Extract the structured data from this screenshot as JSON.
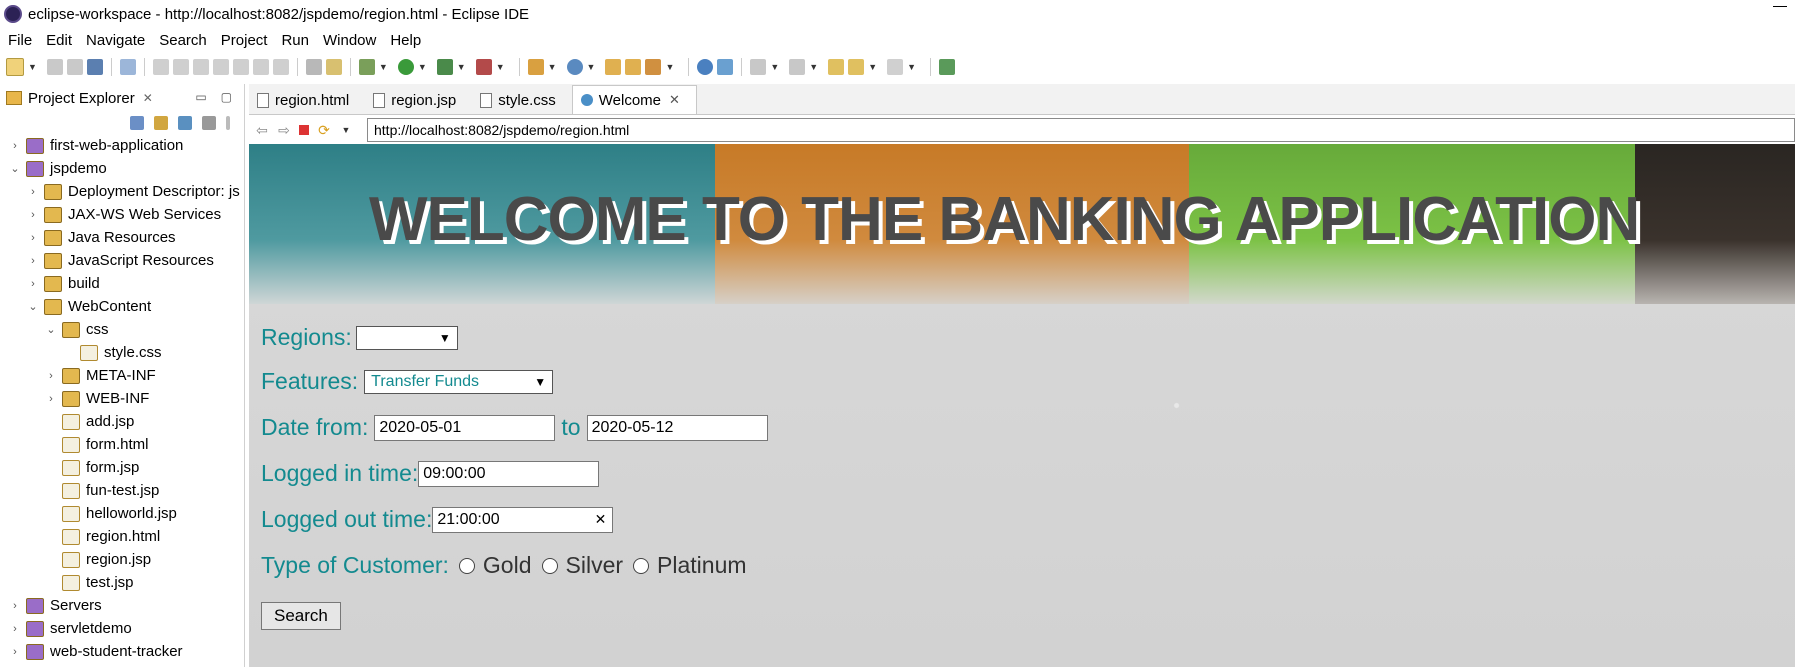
{
  "window": {
    "title": "eclipse-workspace - http://localhost:8082/jspdemo/region.html - Eclipse IDE"
  },
  "menu": [
    "File",
    "Edit",
    "Navigate",
    "Search",
    "Project",
    "Run",
    "Window",
    "Help"
  ],
  "explorer": {
    "title": "Project Explorer",
    "items": [
      {
        "label": "first-web-application",
        "indent": 0,
        "chev": "›"
      },
      {
        "label": "jspdemo",
        "indent": 0,
        "chev": "⌄"
      },
      {
        "label": "Deployment Descriptor: js",
        "indent": 1,
        "chev": "›"
      },
      {
        "label": "JAX-WS Web Services",
        "indent": 1,
        "chev": "›"
      },
      {
        "label": "Java Resources",
        "indent": 1,
        "chev": "›"
      },
      {
        "label": "JavaScript Resources",
        "indent": 1,
        "chev": "›"
      },
      {
        "label": "build",
        "indent": 1,
        "chev": "›"
      },
      {
        "label": "WebContent",
        "indent": 1,
        "chev": "⌄"
      },
      {
        "label": "css",
        "indent": 2,
        "chev": "⌄"
      },
      {
        "label": "style.css",
        "indent": 3,
        "chev": ""
      },
      {
        "label": "META-INF",
        "indent": 2,
        "chev": "›"
      },
      {
        "label": "WEB-INF",
        "indent": 2,
        "chev": "›"
      },
      {
        "label": "add.jsp",
        "indent": 2,
        "chev": ""
      },
      {
        "label": "form.html",
        "indent": 2,
        "chev": ""
      },
      {
        "label": "form.jsp",
        "indent": 2,
        "chev": ""
      },
      {
        "label": "fun-test.jsp",
        "indent": 2,
        "chev": ""
      },
      {
        "label": "helloworld.jsp",
        "indent": 2,
        "chev": ""
      },
      {
        "label": "region.html",
        "indent": 2,
        "chev": ""
      },
      {
        "label": "region.jsp",
        "indent": 2,
        "chev": ""
      },
      {
        "label": "test.jsp",
        "indent": 2,
        "chev": ""
      },
      {
        "label": "Servers",
        "indent": 0,
        "chev": "›"
      },
      {
        "label": "servletdemo",
        "indent": 0,
        "chev": "›"
      },
      {
        "label": "web-student-tracker",
        "indent": 0,
        "chev": "›"
      }
    ]
  },
  "tabs": [
    {
      "label": "region.html",
      "active": false
    },
    {
      "label": "region.jsp",
      "active": false
    },
    {
      "label": "style.css",
      "active": false
    },
    {
      "label": "Welcome",
      "active": true
    }
  ],
  "browser": {
    "url": "http://localhost:8082/jspdemo/region.html"
  },
  "page": {
    "banner_title": "WELCOME TO THE BANKING APPLICATION",
    "regions_label": "Regions:",
    "regions_value": "",
    "features_label": "Features:",
    "features_value": "Transfer Funds",
    "date_from_label": "Date from:",
    "date_from_value": "2020-05-01",
    "date_to_label": "to",
    "date_to_value": "2020-05-12",
    "logged_in_label": "Logged in time:",
    "logged_in_value": "09:00:00",
    "logged_out_label": "Logged out time:",
    "logged_out_value": "21:00:00",
    "customer_label": "Type of Customer:",
    "customer_options": [
      "Gold",
      "Silver",
      "Platinum"
    ],
    "search_label": "Search"
  },
  "colors": {
    "form_text": "#138a8f",
    "banner_teal": "#2e7f86",
    "banner_orange": "#c77a27",
    "banner_green": "#67aa3a"
  }
}
